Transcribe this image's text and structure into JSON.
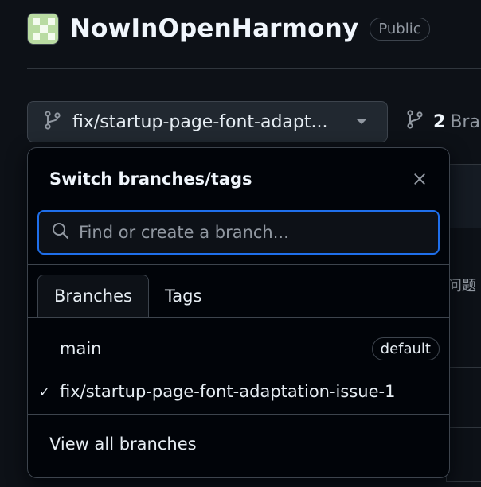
{
  "repo": {
    "name": "NowInOpenHarmony",
    "visibility": "Public"
  },
  "branch_selector": {
    "current_branch": "fix/startup-page-font-adapt...",
    "count": "2",
    "count_label": "Bra"
  },
  "background": {
    "partial_text": "问题"
  },
  "dropdown": {
    "title": "Switch branches/tags",
    "search_placeholder": "Find or create a branch...",
    "tabs": [
      "Branches",
      "Tags"
    ],
    "branches": [
      {
        "name": "main",
        "badge": "default",
        "checked": false
      },
      {
        "name": "fix/startup-page-font-adaptation-issue-1",
        "badge": "",
        "checked": true
      }
    ],
    "check_mark": "✓",
    "view_all": "View all branches"
  },
  "colors": {
    "background": "#0d1117",
    "panel": "#010409",
    "accent_focus": "#1f6feb",
    "border": "#3d444d"
  }
}
